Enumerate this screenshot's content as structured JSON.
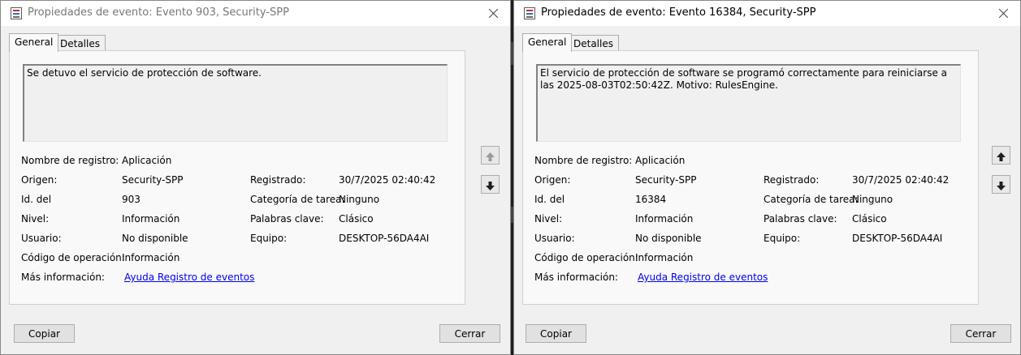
{
  "windows": [
    {
      "title": "Propiedades de evento: Evento 903, Security-SPP",
      "tabs": [
        "General",
        "Detalles"
      ],
      "description": "Se detuvo el servicio de protección de software.",
      "fields": {
        "log_name_label": "Nombre de registro:",
        "log_name": "Aplicación",
        "source_label": "Origen:",
        "source": "Security-SPP",
        "logged_label": "Registrado:",
        "logged": "30/7/2025 02:40:42",
        "event_id_label": "Id. del",
        "event_id": "903",
        "task_label": "Categoría de tarea:",
        "task": "Ninguno",
        "level_label": "Nivel:",
        "level": "Información",
        "keywords_label": "Palabras clave:",
        "keywords": "Clásico",
        "user_label": "Usuario:",
        "user": "No disponible",
        "computer_label": "Equipo:",
        "computer": "DESKTOP-56DA4AI",
        "opcode_label": "Código de operación:",
        "opcode": "Información",
        "more_info_label": "Más información:",
        "more_info_link": "Ayuda Registro de eventos"
      },
      "buttons": {
        "copy": "Copiar",
        "close": "Cerrar"
      }
    },
    {
      "title": "Propiedades de evento: Evento 16384, Security-SPP",
      "tabs": [
        "General",
        "Detalles"
      ],
      "description": "El servicio de protección de software se programó correctamente para reiniciarse a las 2025-08-03T02:50:42Z. Motivo: RulesEngine.",
      "fields": {
        "log_name_label": "Nombre de registro:",
        "log_name": "Aplicación",
        "source_label": "Origen:",
        "source": "Security-SPP",
        "logged_label": "Registrado:",
        "logged": "30/7/2025 02:40:42",
        "event_id_label": "Id. del",
        "event_id": "16384",
        "task_label": "Categoría de tarea:",
        "task": "Ninguno",
        "level_label": "Nivel:",
        "level": "Información",
        "keywords_label": "Palabras clave:",
        "keywords": "Clásico",
        "user_label": "Usuario:",
        "user": "No disponible",
        "computer_label": "Equipo:",
        "computer": "DESKTOP-56DA4AI",
        "opcode_label": "Código de operación:",
        "opcode": "Información",
        "more_info_label": "Más información:",
        "more_info_link": "Ayuda Registro de eventos"
      },
      "buttons": {
        "copy": "Copiar",
        "close": "Cerrar"
      }
    }
  ],
  "icons": {
    "title": "event-properties-icon",
    "close": "close-icon",
    "up": "arrow-up-icon",
    "down": "arrow-down-icon"
  }
}
